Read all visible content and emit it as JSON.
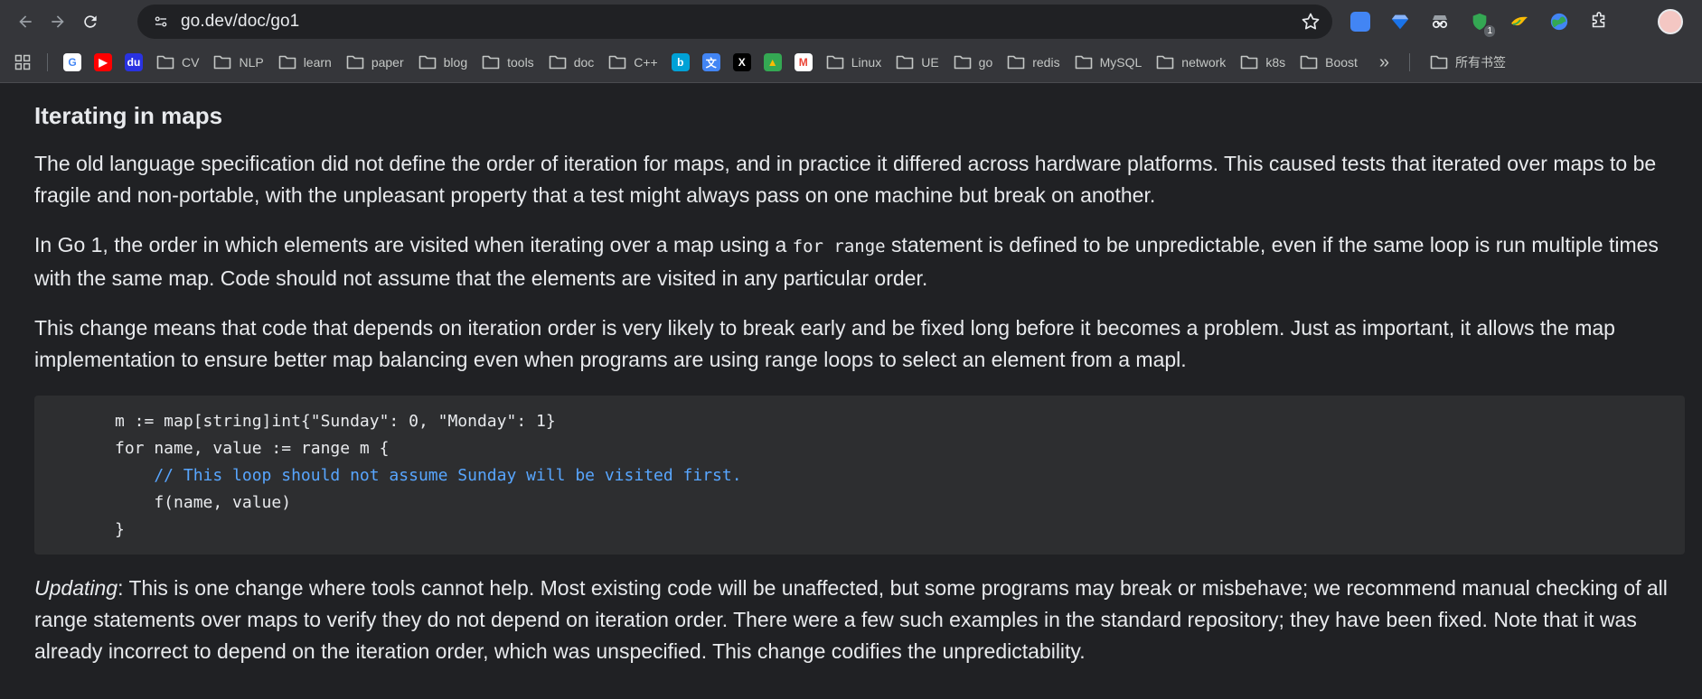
{
  "browser": {
    "url": "go.dev/doc/go1",
    "extension_badge": "1"
  },
  "bookmarks": [
    {
      "type": "favicon",
      "icon": "google-icon",
      "label": ""
    },
    {
      "type": "favicon",
      "icon": "youtube-icon",
      "label": ""
    },
    {
      "type": "favicon",
      "icon": "baidu-icon",
      "label": ""
    },
    {
      "type": "folder",
      "label": "CV"
    },
    {
      "type": "folder",
      "label": "NLP"
    },
    {
      "type": "folder",
      "label": "learn"
    },
    {
      "type": "folder",
      "label": "paper"
    },
    {
      "type": "folder",
      "label": "blog"
    },
    {
      "type": "folder",
      "label": "tools"
    },
    {
      "type": "folder",
      "label": "doc"
    },
    {
      "type": "folder",
      "label": "C++"
    },
    {
      "type": "favicon",
      "icon": "bilibili-icon",
      "label": ""
    },
    {
      "type": "favicon",
      "icon": "translate-icon",
      "label": ""
    },
    {
      "type": "favicon",
      "icon": "x-icon",
      "label": ""
    },
    {
      "type": "favicon",
      "icon": "google-drive-icon",
      "label": ""
    },
    {
      "type": "favicon",
      "icon": "gmail-icon",
      "label": ""
    },
    {
      "type": "folder",
      "label": "Linux"
    },
    {
      "type": "folder",
      "label": "UE"
    },
    {
      "type": "folder",
      "label": "go"
    },
    {
      "type": "folder",
      "label": "redis"
    },
    {
      "type": "folder",
      "label": "MySQL"
    },
    {
      "type": "folder",
      "label": "network"
    },
    {
      "type": "folder",
      "label": "k8s"
    },
    {
      "type": "folder",
      "label": "Boost"
    }
  ],
  "bookmarks_overflow_label": "»",
  "all_bookmarks_label": "所有书签",
  "article": {
    "heading": "Iterating in maps",
    "p1": "The old language specification did not define the order of iteration for maps, and in practice it differed across hardware platforms. This caused tests that iterated over maps to be fragile and non-portable, with the unpleasant property that a test might always pass on one machine but break on another.",
    "p2_before": "In Go 1, the order in which elements are visited when iterating over a map using a ",
    "p2_code": "for range",
    "p2_after": " statement is defined to be unpredictable, even if the same loop is run multiple times with the same map. Code should not assume that the elements are visited in any particular order.",
    "p3": "This change means that code that depends on iteration order is very likely to break early and be fixed long before it becomes a problem. Just as important, it allows the map implementation to ensure better map balancing even when programs are using range loops to select an element from a mapl.",
    "code_lines": [
      "m := map[string]int{\"Sunday\": 0, \"Monday\": 1}",
      "for name, value := range m {",
      "    // This loop should not assume Sunday will be visited first.",
      "    f(name, value)",
      "}"
    ],
    "p4_em": "Updating",
    "p4_rest": ": This is one change where tools cannot help. Most existing code will be unaffected, but some programs may break or misbehave; we recommend manual checking of all range statements over maps to verify they do not depend on iteration order. There were a few such examples in the standard repository; they have been fixed. Note that it was already incorrect to depend on the iteration order, which was unspecified. This change codifies the unpredictability."
  }
}
